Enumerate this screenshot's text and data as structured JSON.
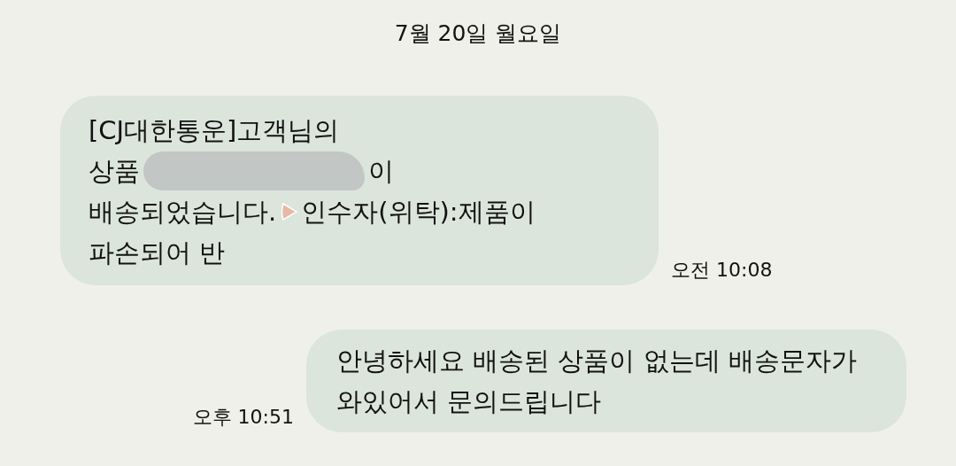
{
  "date_divider": "7월 20일 월요일",
  "messages": [
    {
      "kind": "incoming",
      "time": "오전 10:08",
      "lines": [
        [
          {
            "kind": "text",
            "text": "[CJ대한통운]고객님의"
          }
        ],
        [
          {
            "kind": "text",
            "text": "상품"
          },
          {
            "kind": "redaction"
          },
          {
            "kind": "text",
            "text": "이"
          }
        ],
        [
          {
            "kind": "text",
            "text": "배송되었습니다."
          },
          {
            "kind": "icon"
          },
          {
            "kind": "text",
            "text": "인수자(위탁):제품이"
          }
        ],
        [
          {
            "kind": "text",
            "text": "파손되어 반"
          }
        ]
      ]
    },
    {
      "kind": "outgoing",
      "time": "오후 10:51",
      "lines": [
        [
          {
            "kind": "text",
            "text": "안녕하세요 배송된 상품이 없는데 배송문자가"
          }
        ],
        [
          {
            "kind": "text",
            "text": "와있어서 문의드립니다"
          }
        ]
      ]
    }
  ]
}
